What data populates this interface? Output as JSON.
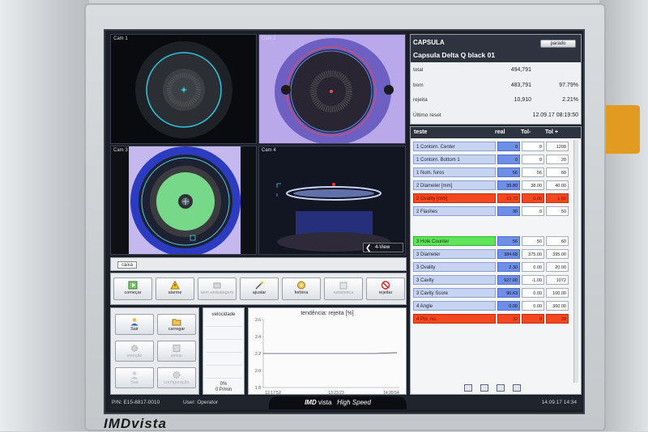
{
  "brand": "IMDvista",
  "cameras": {
    "cam1": "Cam 1",
    "cam2": "Cam 2",
    "cam3": "Cam 3",
    "cam4": "Cam 4",
    "view_button": "4-View"
  },
  "tag": "caixa",
  "toolbar": [
    {
      "label": "começar",
      "icon": "play-icon",
      "dim": false
    },
    {
      "label": "alarme",
      "icon": "warning-icon",
      "dim": false
    },
    {
      "label": "sem embalagem",
      "icon": "box-icon",
      "dim": true
    },
    {
      "label": "ajustar",
      "icon": "wand-icon",
      "dim": false
    },
    {
      "label": "forbina",
      "icon": "cd-icon",
      "dim": false
    },
    {
      "label": "estatística",
      "icon": "stats-icon",
      "dim": true
    },
    {
      "label": "rejeitar",
      "icon": "reject-icon",
      "dim": false
    }
  ],
  "side_buttons": [
    {
      "label": "Sair",
      "icon": "user-icon",
      "dim": false
    },
    {
      "label": "carregar",
      "icon": "folder-icon",
      "dim": false
    },
    {
      "label": "seleção",
      "icon": "gear-icon",
      "dim": true
    },
    {
      "label": "salvar",
      "icon": "disk-icon",
      "dim": true
    },
    {
      "label": "Sair",
      "icon": "exit-icon",
      "dim": true
    },
    {
      "label": "configuração",
      "icon": "config-icon",
      "dim": true
    }
  ],
  "speed": {
    "title": "velocidade",
    "percent": "0%",
    "rate": "0 P/min"
  },
  "trend": {
    "title": "tendência: rejeita [%]",
    "yticks": [
      "2.6",
      "2.4",
      "2.2",
      "2.0",
      "1.8"
    ],
    "xticks": [
      "12:17:52",
      "13:23:23",
      "14:28:54"
    ],
    "ylim": [
      1.8,
      2.6
    ],
    "series": [
      2.2,
      2.2,
      2.2,
      2.2,
      2.2,
      2.2,
      2.21
    ]
  },
  "stats": {
    "title": "CAPSULA",
    "product": "Capsula Delta Q black 01",
    "stop_label": "parado",
    "rows": [
      {
        "label": "total",
        "v1": "494,791",
        "v2": ""
      },
      {
        "label": "bom",
        "v1": "483,791",
        "v2": "97.79%"
      },
      {
        "label": "rejeita",
        "v1": "10,910",
        "v2": "2.21%"
      },
      {
        "label": "Último reset",
        "v1": "",
        "v2": "12.09.17 08:19:50"
      }
    ]
  },
  "tests": {
    "headers": {
      "name": "teste",
      "real": "real",
      "tol_minus": "Tol-",
      "tol_plus": "Tol +"
    },
    "rows": [
      {
        "name": "1 Contorn. Center",
        "real": "0",
        "tmin": "0",
        "tmax": "1200",
        "state": "normal"
      },
      {
        "name": "1 Contorn. Bottom 1",
        "real": "0",
        "tmin": "0",
        "tmax": "20",
        "state": "normal"
      },
      {
        "name": "1 Num. furos",
        "real": "56",
        "tmin": "56",
        "tmax": "60",
        "state": "normal"
      },
      {
        "name": "2 Diameter [mm]",
        "real": "39.80",
        "tmin": "38.00",
        "tmax": "40.00",
        "state": "normal"
      },
      {
        "name": "2 Ovality [mm]",
        "real": "13.70",
        "tmin": "0.00",
        "tmax": "1.50",
        "state": "red"
      },
      {
        "name": "2 Flashes",
        "real": "30",
        "tmin": "0",
        "tmax": "50",
        "state": "normal"
      },
      {
        "name": "3 Hole Counter",
        "real": "56",
        "tmin": "50",
        "tmax": "60",
        "state": "green"
      },
      {
        "name": "3 Diameter",
        "real": "384.68",
        "tmin": "375.00",
        "tmax": "395.00",
        "state": "normal"
      },
      {
        "name": "3 Ovality",
        "real": "2.30",
        "tmin": "0.00",
        "tmax": "20.00",
        "state": "normal"
      },
      {
        "name": "3 Cavity",
        "real": "927.00",
        "tmin": "-1.00",
        "tmax": "1072",
        "state": "normal"
      },
      {
        "name": "3 Cavity Score",
        "real": "90.63",
        "tmin": "0.00",
        "tmax": "100.00",
        "state": "normal"
      },
      {
        "name": "4 Angle",
        "real": "0.00",
        "tmin": "0.00",
        "tmax": "360.00",
        "state": "normal"
      },
      {
        "name": "4 Pin. no.",
        "real": "32",
        "tmin": "0",
        "tmax": "28",
        "state": "red"
      }
    ]
  },
  "status_bar": {
    "part_number": "P/N: E15-8817-0010",
    "user": "User: Operator",
    "logo_brand": "IMD",
    "logo_vista": "vista",
    "logo_tag": "High Speed",
    "datetime": "14.09.17 14:34"
  }
}
